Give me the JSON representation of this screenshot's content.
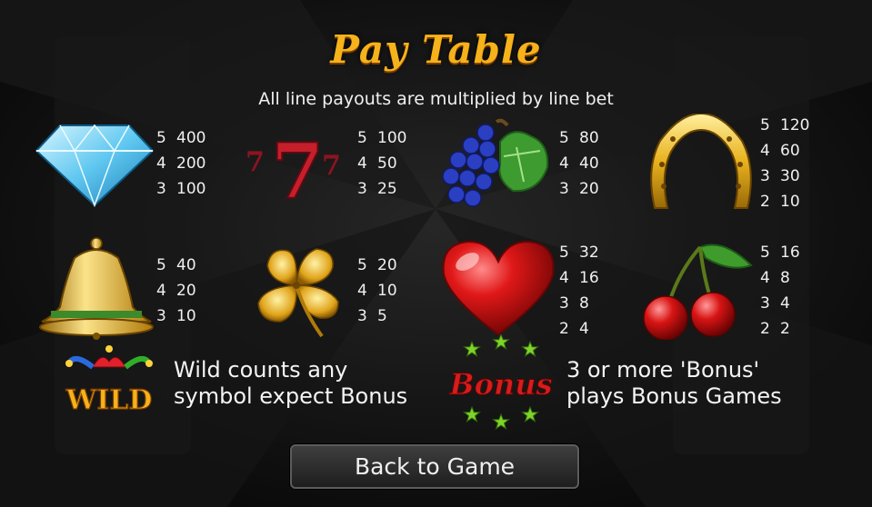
{
  "header": {
    "title": "Pay Table",
    "subtitle": "All line payouts are multiplied by line bet"
  },
  "symbols": [
    {
      "name": "diamond",
      "icon": "diamond-icon",
      "payouts": [
        [
          "5",
          "400"
        ],
        [
          "4",
          "200"
        ],
        [
          "3",
          "100"
        ]
      ]
    },
    {
      "name": "seven",
      "icon": "seven-icon",
      "payouts": [
        [
          "5",
          "100"
        ],
        [
          "4",
          "50"
        ],
        [
          "3",
          "25"
        ]
      ]
    },
    {
      "name": "grapes",
      "icon": "grapes-icon",
      "payouts": [
        [
          "5",
          "80"
        ],
        [
          "4",
          "40"
        ],
        [
          "3",
          "20"
        ]
      ]
    },
    {
      "name": "horseshoe",
      "icon": "horseshoe-icon",
      "payouts": [
        [
          "5",
          "120"
        ],
        [
          "4",
          "60"
        ],
        [
          "3",
          "30"
        ],
        [
          "2",
          "10"
        ]
      ]
    },
    {
      "name": "bell",
      "icon": "bell-icon",
      "payouts": [
        [
          "5",
          "40"
        ],
        [
          "4",
          "20"
        ],
        [
          "3",
          "10"
        ]
      ]
    },
    {
      "name": "clover",
      "icon": "clover-icon",
      "payouts": [
        [
          "5",
          "20"
        ],
        [
          "4",
          "10"
        ],
        [
          "3",
          "5"
        ]
      ]
    },
    {
      "name": "heart",
      "icon": "heart-icon",
      "payouts": [
        [
          "5",
          "32"
        ],
        [
          "4",
          "16"
        ],
        [
          "3",
          "8"
        ],
        [
          "2",
          "4"
        ]
      ]
    },
    {
      "name": "cherries",
      "icon": "cherries-icon",
      "payouts": [
        [
          "5",
          "16"
        ],
        [
          "4",
          "8"
        ],
        [
          "3",
          "4"
        ],
        [
          "2",
          "2"
        ]
      ]
    }
  ],
  "specials": {
    "wild_logo": "WILD",
    "wild_text_line1": "Wild counts any",
    "wild_text_line2": "symbol expect Bonus",
    "bonus_logo": "Bonus",
    "bonus_text_line1": "3 or more 'Bonus'",
    "bonus_text_line2": "plays Bonus Games"
  },
  "back_button": "Back to Game",
  "colors": {
    "title": "#f6b21a",
    "background": "#0d0d0d",
    "bonus_red": "#d71c1c",
    "star_green": "#7fd32a"
  }
}
